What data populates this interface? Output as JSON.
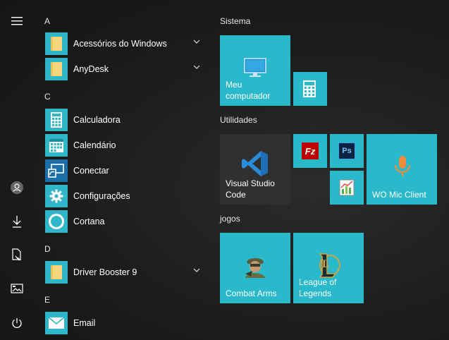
{
  "rail": {
    "icons": [
      "hamburger-menu-icon",
      "user-account-icon",
      "downloads-icon",
      "documents-icon",
      "pictures-icon",
      "power-icon"
    ]
  },
  "applist": {
    "sections": [
      {
        "letter": "A"
      },
      {
        "letter": "C"
      },
      {
        "letter": "D"
      },
      {
        "letter": "E"
      }
    ],
    "apps": [
      {
        "label": "Acessórios do Windows",
        "icon": "folder-icon",
        "expandable": true
      },
      {
        "label": "AnyDesk",
        "icon": "folder-icon",
        "expandable": true
      },
      {
        "label": "Calculadora",
        "icon": "calculator-icon",
        "expandable": false
      },
      {
        "label": "Calendário",
        "icon": "calendar-icon",
        "expandable": false
      },
      {
        "label": "Conectar",
        "icon": "connect-icon",
        "expandable": false
      },
      {
        "label": "Configurações",
        "icon": "settings-gear-icon",
        "expandable": false
      },
      {
        "label": "Cortana",
        "icon": "cortana-icon",
        "expandable": false
      },
      {
        "label": "Driver Booster 9",
        "icon": "folder-icon",
        "expandable": true
      },
      {
        "label": "Email",
        "icon": "mail-icon",
        "expandable": false
      }
    ]
  },
  "groups": {
    "sistema": {
      "title": "Sistema"
    },
    "utilidades": {
      "title": "Utilidades"
    },
    "jogos": {
      "title": "jogos"
    }
  },
  "tiles": {
    "meu_computador": {
      "line1": "Meu",
      "line2": "computador",
      "icon": "monitor-icon"
    },
    "calculadora_small": {
      "icon": "calculator-icon"
    },
    "vscode": {
      "line1": "Visual Studio",
      "line2": "Code",
      "icon": "vscode-icon"
    },
    "filezilla": {
      "icon": "filezilla-icon",
      "glyph": "Fz"
    },
    "photoshop": {
      "icon": "photoshop-icon",
      "glyph": "Ps"
    },
    "chart_app": {
      "icon": "chart-app-icon"
    },
    "wo_mic": {
      "line1": "WO Mic Client",
      "icon": "microphone-icon"
    },
    "combat_arms": {
      "line1": "Combat Arms",
      "icon": "soldier-icon"
    },
    "league": {
      "line1": "League of",
      "line2": "Legends",
      "icon": "league-of-legends-icon",
      "glyph": "L"
    }
  },
  "colors": {
    "accent": "#2ab9cb",
    "background": "#1c1c1c",
    "dark_tile": "#303030",
    "vscode_blue": "#2a8bd9",
    "mic_orange": "#f08a3c",
    "folder_yellow": "#f6d77c"
  }
}
